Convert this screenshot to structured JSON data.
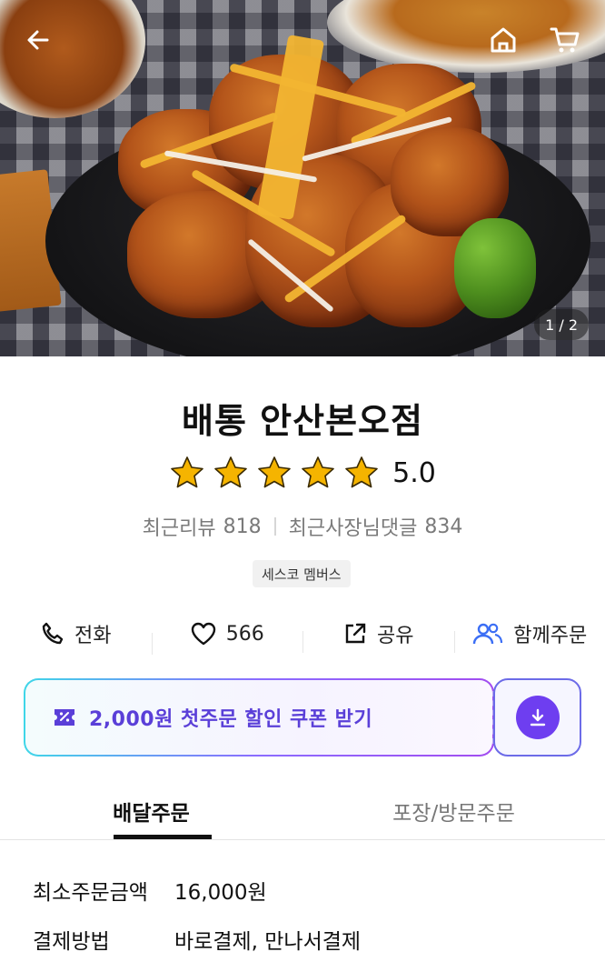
{
  "hero": {
    "page_indicator": "1 / 2",
    "back_icon": "arrow-left-icon",
    "home_icon": "home-icon",
    "cart_icon": "cart-icon"
  },
  "store": {
    "name": "배통 안산본오점",
    "rating": "5.0",
    "stars": 5,
    "star_color": "#f5b400",
    "recent_reviews_label": "최근리뷰",
    "recent_reviews_count": "818",
    "owner_replies_label": "최근사장님댓글",
    "owner_replies_count": "834",
    "badge": "세스코 멤버스"
  },
  "actions": [
    {
      "icon": "phone-icon",
      "label": "전화"
    },
    {
      "icon": "heart-icon",
      "label": "566"
    },
    {
      "icon": "share-icon",
      "label": "공유"
    },
    {
      "icon": "group-icon",
      "label": "함께주문",
      "color": "#3b6ef5"
    }
  ],
  "coupon": {
    "icon": "coupon-ticket-icon",
    "text": "2,000원 첫주문 할인 쿠폰 받기",
    "download_icon": "download-icon",
    "accent": "#6e3ef0"
  },
  "tabs": [
    {
      "label": "배달주문",
      "active": true
    },
    {
      "label": "포장/방문주문",
      "active": false
    }
  ],
  "info": {
    "min_order_label": "최소주문금액",
    "min_order_value": "16,000원",
    "payment_label": "결제방법",
    "payment_value": "바로결제, 만나서결제"
  }
}
